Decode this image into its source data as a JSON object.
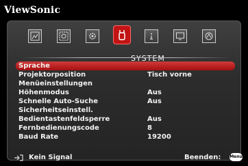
{
  "brand": "ViewSonic",
  "colors": {
    "accent": "#c21414",
    "background": "#000000",
    "panel": "#2d2d2d"
  },
  "tabs": [
    {
      "icon": "picture-icon"
    },
    {
      "icon": "display-icon"
    },
    {
      "icon": "setup-icon"
    },
    {
      "icon": "system-icon",
      "active": true
    },
    {
      "icon": "info-icon"
    },
    {
      "icon": "screen-icon"
    },
    {
      "icon": "advanced-icon"
    }
  ],
  "section_title": "SYSTEM",
  "menu": [
    {
      "label": "Sprache",
      "value": "",
      "selected": true
    },
    {
      "label": "Projektorposition",
      "value": "Tisch vorne"
    },
    {
      "label": "Menüeinstellungen",
      "value": ""
    },
    {
      "label": "Höhenmodus",
      "value": "Aus"
    },
    {
      "label": "Schnelle Auto-Suche",
      "value": "Aus"
    },
    {
      "label": "Sicherheitseinstell.",
      "value": ""
    },
    {
      "label": "Bedientastenfeldsperre",
      "value": "Aus"
    },
    {
      "label": "Fernbedienungscode",
      "value": "8"
    },
    {
      "label": "Baud Rate",
      "value": "19200"
    }
  ],
  "footer": {
    "signal_text": "Kein Signal",
    "exit_text": "Beenden:",
    "menu_button": "Menu"
  }
}
